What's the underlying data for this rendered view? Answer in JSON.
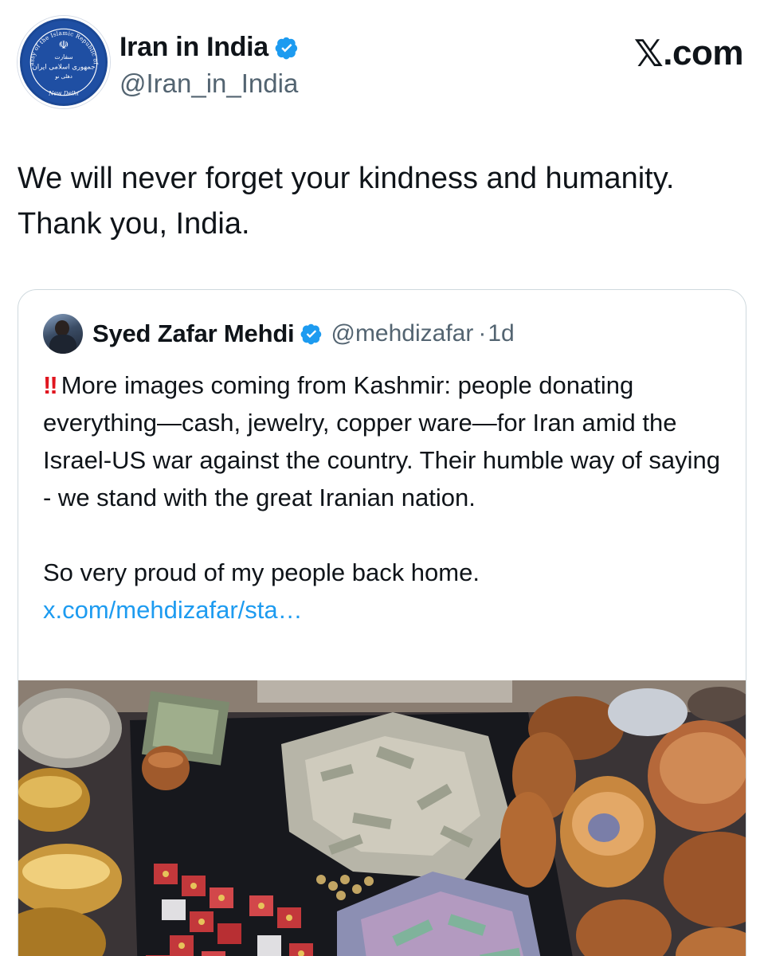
{
  "post": {
    "author": {
      "display_name": "Iran in India",
      "handle": "@Iran_in_India",
      "verified": true,
      "avatar_icon": "embassy-emblem-icon",
      "avatar_text": [
        "Embassy of the Islamic Republic of Iran",
        "سفارت",
        "جمهوری اسلامی ایران",
        "دهلی نو",
        "New Delhi"
      ]
    },
    "brand": {
      "label": ".com",
      "x_glyph": "𝕏"
    },
    "text": "We will never forget your kindness and humanity.\nThank you, India."
  },
  "quoted": {
    "author": {
      "display_name": "Syed Zafar Mehdi",
      "handle": "@mehdizafar",
      "separator": "·",
      "time": "1d",
      "verified": true
    },
    "bangs": "‼",
    "paragraph1": "More images coming from Kashmir: people donating everything—cash, jewelry, copper ware—for Iran amid the Israel-US war against the country. Their humble way of saying - we stand with the great Iranian nation.",
    "paragraph2": "So very proud of my people back home. ",
    "link": "x.com/mehdizafar/sta…",
    "media_description_icon": "donations-photo-icon"
  },
  "colors": {
    "accent_link": "#1d9bf0",
    "verified_badge": "#1d9bf0",
    "secondary_text": "#536471",
    "border": "#cfd9de",
    "bangs": "#e0161f"
  }
}
